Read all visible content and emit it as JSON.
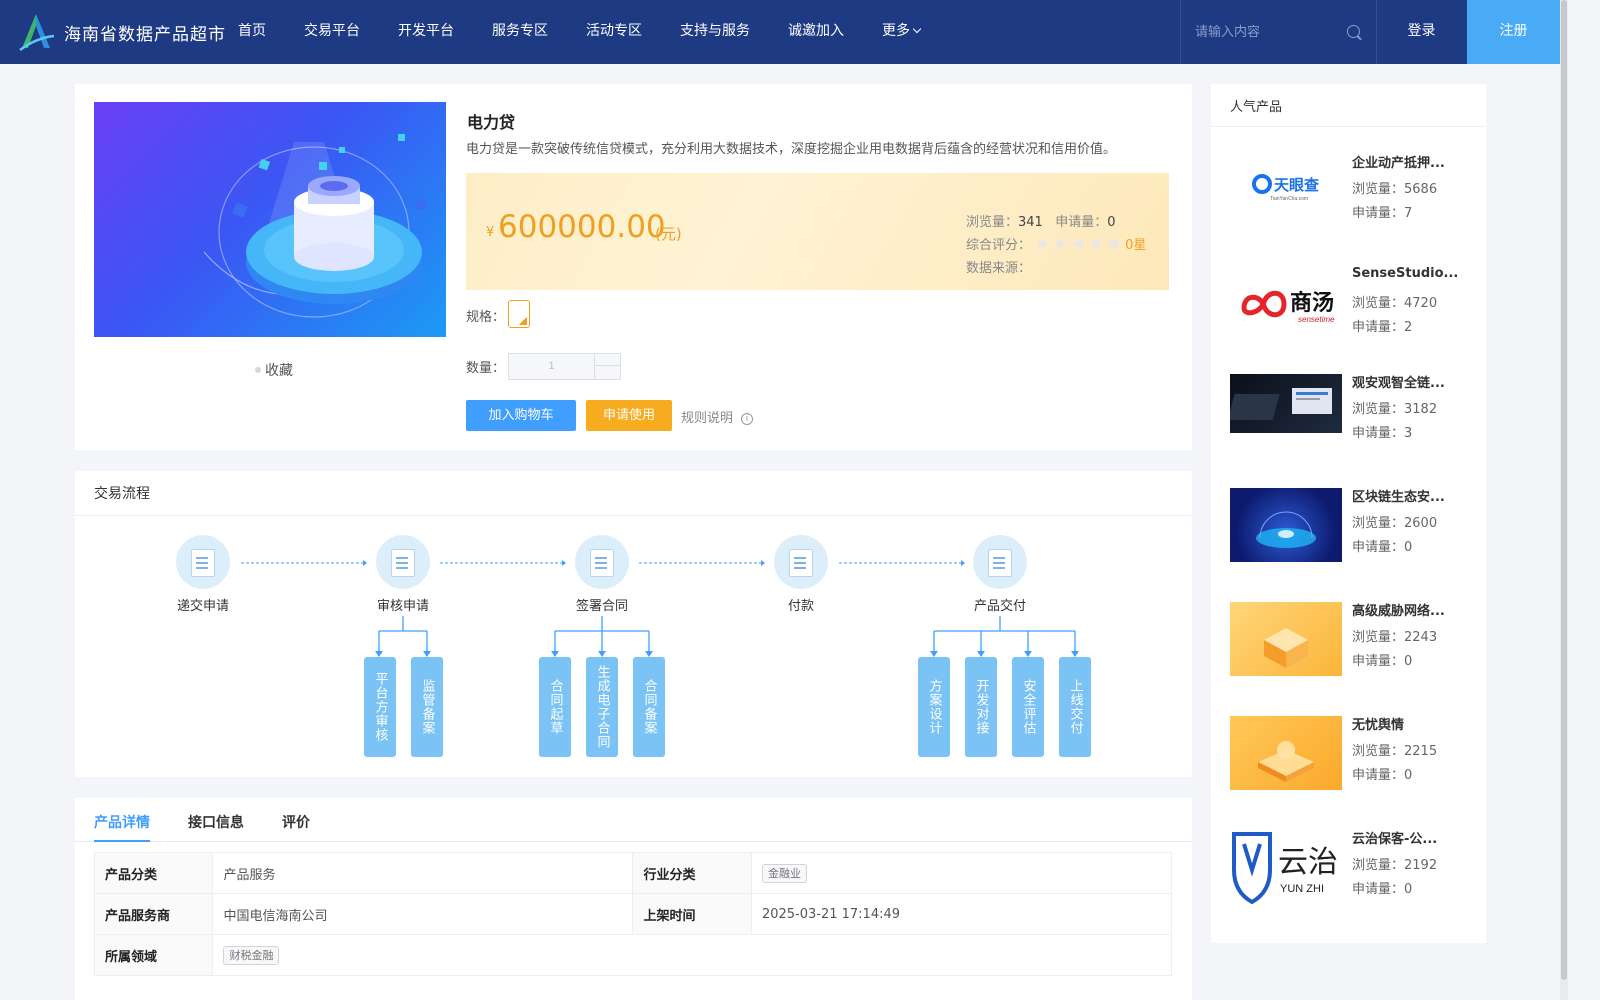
{
  "header": {
    "site_title": "海南省数据产品超市",
    "nav": [
      "首页",
      "交易平台",
      "开发平台",
      "服务专区",
      "活动专区",
      "支持与服务",
      "诚邀加入",
      "更多"
    ],
    "search_placeholder": "请输入内容",
    "login": "登录",
    "register": "注册"
  },
  "product": {
    "name": "电力贷",
    "description": "电力贷是一款突破传统信贷模式，充分利用大数据技术，深度挖掘企业用电数据背后蕴含的经营状况和信用价值。",
    "currency_symbol": "¥",
    "price": "600000.00",
    "unit": "(元)",
    "views_label": "浏览量：",
    "views": "341",
    "apps_label": "申请量：",
    "apps": "0",
    "rating_label": "综合评分：",
    "rating_text": "0星",
    "rating_stars": 0,
    "source_label": "数据来源：",
    "spec_label": "规格：",
    "qty_label": "数量：",
    "qty_value": "1",
    "favorite": "收藏",
    "add_to_cart": "加入购物车",
    "apply": "申请使用",
    "rules": "规则说明"
  },
  "process": {
    "title": "交易流程",
    "steps": [
      "递交申请",
      "审核申请",
      "签署合同",
      "付款",
      "产品交付"
    ],
    "substeps": {
      "review": [
        "平台方审核",
        "监管备案"
      ],
      "contract": [
        "合同起草",
        "生成电子合同",
        "合同备案"
      ],
      "delivery": [
        "方案设计",
        "开发对接",
        "安全评估",
        "上线交付"
      ]
    }
  },
  "tabs": {
    "items": [
      "产品详情",
      "接口信息",
      "评价"
    ],
    "active": "产品详情"
  },
  "details": {
    "category_label": "产品分类",
    "category": "产品服务",
    "industry_label": "行业分类",
    "industry": "金融业",
    "provider_label": "产品服务商",
    "provider": "中国电信海南公司",
    "listed_label": "上架时间",
    "listed": "2025-03-21 17:14:49",
    "domain_label": "所属领域",
    "domain": "财税金融"
  },
  "popular": {
    "title": "人气产品",
    "views_label": "浏览量：",
    "apps_label": "申请量：",
    "items": [
      {
        "name": "企业动产抵押...",
        "views": "5686",
        "apps": "7",
        "logo_text": "天眼查",
        "logo_sub": "TianYanCha.com"
      },
      {
        "name": "SenseStudio...",
        "views": "4720",
        "apps": "2",
        "logo_text": "商汤",
        "logo_sub": "sensetime"
      },
      {
        "name": "观安观智全链...",
        "views": "3182",
        "apps": "3"
      },
      {
        "name": "区块链生态安...",
        "views": "2600",
        "apps": "0"
      },
      {
        "name": "高级威胁网络...",
        "views": "2243",
        "apps": "0"
      },
      {
        "name": "无忧舆情",
        "views": "2215",
        "apps": "0"
      },
      {
        "name": "云治保客-公...",
        "views": "2192",
        "apps": "0",
        "logo_text": "云治",
        "logo_sub": "YUN ZHI"
      }
    ]
  },
  "colors": {
    "header_bg": "#1d3a83",
    "register_bg": "#49aaf5",
    "primary": "#409eff",
    "accent": "#f7ab1f",
    "price": "#f0a020"
  }
}
